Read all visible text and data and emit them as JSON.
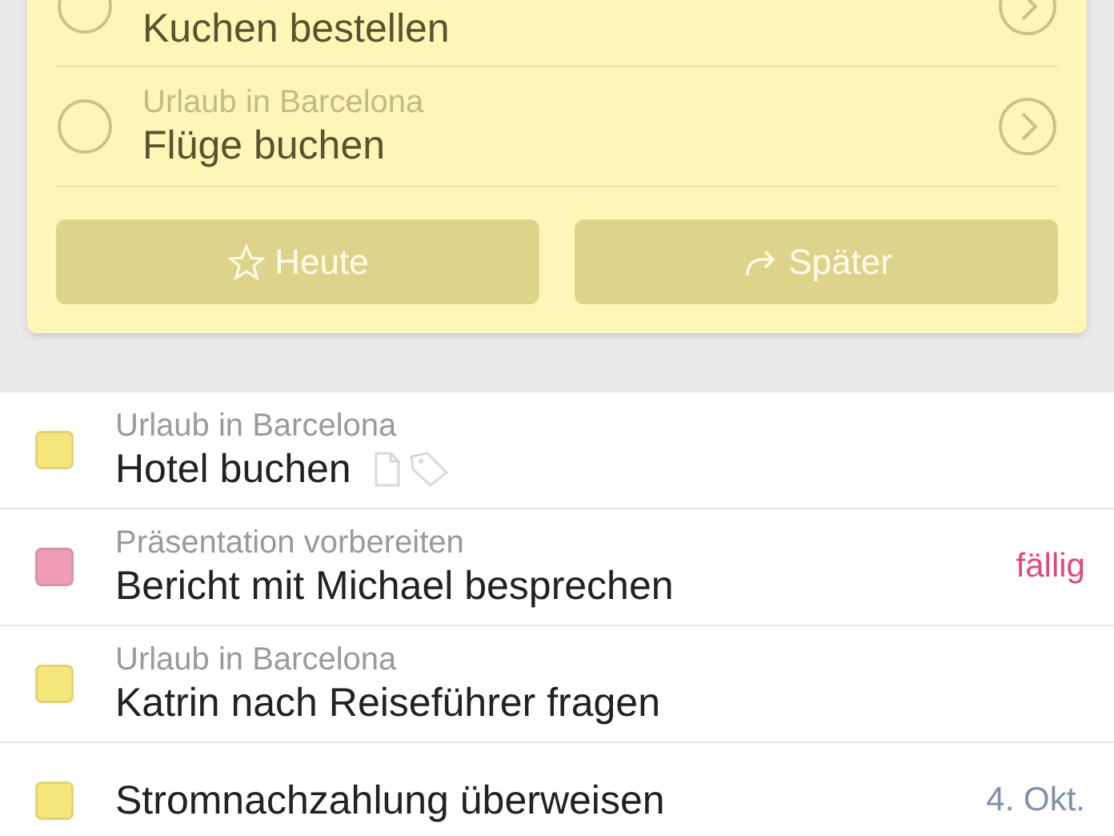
{
  "suggestions": {
    "items": [
      {
        "title": "Kuchen bestellen"
      },
      {
        "project": "Urlaub in Barcelona",
        "title": "Flüge buchen"
      }
    ],
    "buttons": [
      {
        "kind": "today",
        "label": "Heute",
        "disabled": true
      },
      {
        "kind": "later",
        "label": "Später",
        "disabled": true
      }
    ]
  },
  "tasks": [
    {
      "project": "Urlaub in Barcelona",
      "title": "Hotel buchen",
      "color": "#f5e67c",
      "attachments": [
        {
          "kind": "note"
        },
        {
          "kind": "tag"
        }
      ]
    },
    {
      "project": "Präsentation vorbereiten",
      "title": "Bericht mit Michael besprechen",
      "color": "#ee9db5",
      "due": {
        "text": "fällig",
        "kind": "overdue"
      }
    },
    {
      "project": "Urlaub in Barcelona",
      "title": "Katrin nach Reiseführer fragen",
      "color": "#f5e67c"
    },
    {
      "title": "Stromnachzahlung überweisen",
      "color": "#f5e67c",
      "due": {
        "text": "4. Okt.",
        "kind": "date"
      }
    }
  ]
}
